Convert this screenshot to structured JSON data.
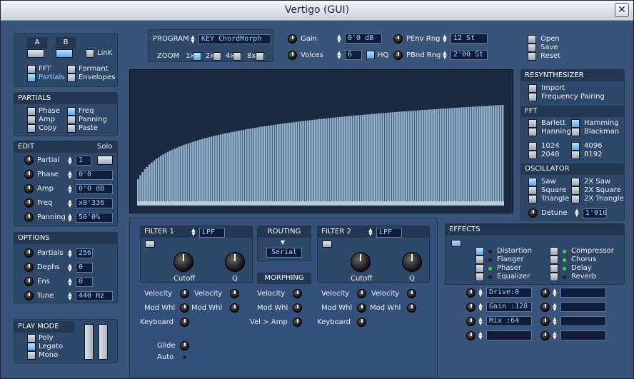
{
  "window": {
    "title": "Vertigo (GUI)",
    "close_icon": "✕"
  },
  "ab": {
    "a": "A",
    "b": "B",
    "link": "LinK",
    "fft": "FFT",
    "formant": "Formant",
    "partials": "Partials",
    "envelopes": "Envelopes"
  },
  "partials": {
    "header": "PARTIALS",
    "phase": "Phase",
    "freq": "Freq",
    "amp": "Amp",
    "panning": "Panning",
    "copy": "Copy",
    "paste": "Paste"
  },
  "edit": {
    "header": "EDIT",
    "solo": "Solo",
    "partial": "Partial",
    "partial_val": "1",
    "phase": "Phase",
    "phase_val": "0'0",
    "amp": "Amp",
    "amp_val": "0'0 dB",
    "freq": "Freq",
    "freq_val": "x0'336",
    "panning": "Panning",
    "panning_val": "50'0%"
  },
  "options": {
    "header": "OPTIONS",
    "partials": "Partials",
    "partials_val": "256",
    "dephs": "Dephs",
    "dephs_val": "0",
    "ens": "Ens",
    "ens_val": "0",
    "tune": "Tune",
    "tune_val": "440 Hz"
  },
  "playmode": {
    "header": "PLAY MODE",
    "poly": "Poly",
    "legato": "Legato",
    "mono": "Mono"
  },
  "top": {
    "program": "PROGRAM",
    "program_val": "KEY ChordMorph",
    "zoom": "ZOOM",
    "z1": "1x",
    "z2": "2x",
    "z4": "4x",
    "z8": "8x",
    "gain": "Gain",
    "gain_val": "0'0 dB",
    "voices": "Voices",
    "voices_val": "6",
    "hq": "HQ",
    "penv": "PEnv Rng",
    "penv_val": "12 St",
    "pbnd": "PBnd Rng",
    "pbnd_val": "2'00 St"
  },
  "file": {
    "open": "Open",
    "save": "Save",
    "reset": "Reset"
  },
  "resynth": {
    "header": "RESYNTHESIZER",
    "import": "Import",
    "freq_pairing": "Frequency Pairing"
  },
  "fft": {
    "header": "FFT",
    "bartlett": "Barlett",
    "hamming": "Hamming",
    "hanning": "Hanning",
    "blackman": "Blackman",
    "s1024": "1024",
    "s4096": "4096",
    "s2048": "2048",
    "s8192": "8192"
  },
  "osc": {
    "header": "OSCILLATOR",
    "saw": "Saw",
    "saw2": "2X Saw",
    "square": "Square",
    "square2": "2X Square",
    "triangle": "Triangle",
    "triangle2": "2X Triangle",
    "detune": "Detune",
    "detune_val": "1'010"
  },
  "filter1": {
    "header": "FILTER 1",
    "type": "LPF",
    "cutoff": "Cutoff",
    "q": "Q",
    "velocity": "Velocity",
    "velocity2": "Velocity",
    "modwhl": "Mod Whl",
    "modwhl2": "Mod Whl",
    "keyboard": "Keyboard",
    "glide": "Glide",
    "auto": "Auto"
  },
  "routing": {
    "header": "ROUTING",
    "value": "Serial"
  },
  "morphing": {
    "header": "MORPHING",
    "velocity": "Velocity",
    "modwhl": "Mod Whl",
    "velamp": "Vel > Amp"
  },
  "filter2": {
    "header": "FILTER 2",
    "type": "LPF",
    "cutoff": "Cutoff",
    "q": "Q",
    "velocity": "Velocity",
    "velocity2": "Velocity",
    "modwhl": "Mod Whl",
    "modwhl2": "Mod Whl",
    "keyboard": "Keyboard"
  },
  "effects": {
    "header": "EFFECTS",
    "distortion": "Distortion",
    "flanger": "Flanger",
    "phaser": "Phaser",
    "equalizer": "Equalizer",
    "compressor": "Compressor",
    "chorus": "Chorus",
    "delay": "Delay",
    "reverb": "Reverb",
    "p1": "Drive:0",
    "p2": "Gain :128",
    "p3": "Mix  :64",
    "p4": ""
  },
  "chart_data": {
    "type": "bar",
    "bars": 160,
    "ylim": [
      0,
      1
    ],
    "description_of_shape": "ascending log-like curve"
  },
  "colors": {
    "accent": "#5aa8e8",
    "bars": "#8fb0c8",
    "display_bg": "#1c2a40"
  }
}
